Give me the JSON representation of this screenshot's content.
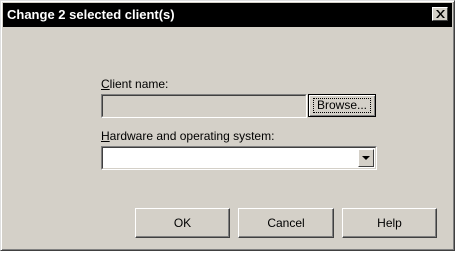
{
  "dialog": {
    "title": "Change 2 selected client(s)"
  },
  "client_name": {
    "label_mnemonic": "C",
    "label_rest": "lient name:",
    "value": "",
    "browse_label": "Browse..."
  },
  "hardware": {
    "label_mnemonic": "H",
    "label_rest": "ardware and operating system:",
    "selected_value": ""
  },
  "buttons": {
    "ok": "OK",
    "cancel": "Cancel",
    "help": "Help"
  },
  "icons": {
    "close": "close-icon",
    "dropdown": "chevron-down-icon"
  }
}
